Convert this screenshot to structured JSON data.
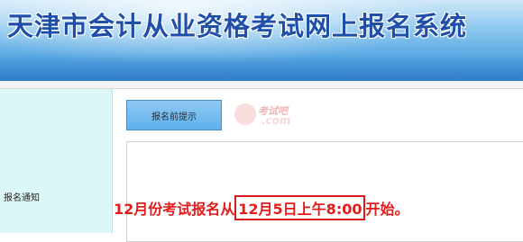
{
  "header": {
    "title": "天津市会计从业资格考试网上报名系统"
  },
  "sidebar": {
    "items": [
      {
        "label": "报名通知"
      }
    ]
  },
  "main": {
    "tab_button": "报名前提示",
    "watermark": {
      "top": "考试吧",
      "bottom": ".com"
    },
    "notice": {
      "prefix": "12月份考试报名从",
      "highlight": "12月5日上午8:00",
      "suffix": "开始。"
    }
  },
  "colors": {
    "title": "#1f4fa8",
    "notice": "#e31b1b",
    "sidebar_bg": "#dcf7f7",
    "button_bg": "#5fb1ec"
  }
}
